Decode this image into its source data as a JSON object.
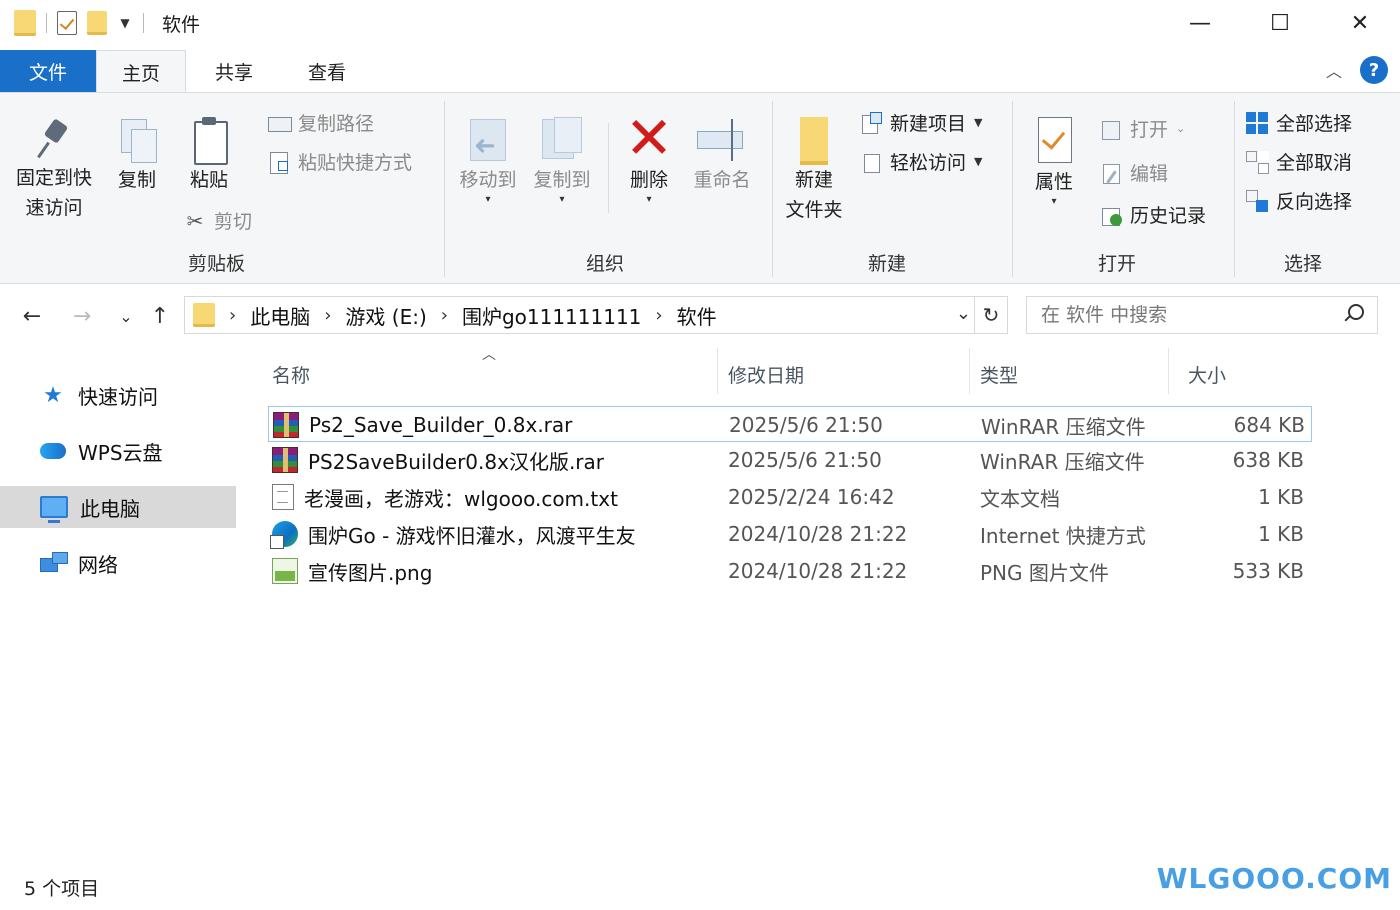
{
  "window": {
    "title": "软件",
    "minimize": "—",
    "maximize": "☐",
    "close": "✕"
  },
  "tabs": {
    "file": "文件",
    "home": "主页",
    "share": "共享",
    "view": "查看"
  },
  "ribbon": {
    "clipboard": {
      "label": "剪贴板",
      "pin_line1": "固定到快",
      "pin_line2": "速访问",
      "copy": "复制",
      "paste": "粘贴",
      "copy_path": "复制路径",
      "paste_shortcut": "粘贴快捷方式",
      "cut": "剪切"
    },
    "organize": {
      "label": "组织",
      "move_to": "移动到",
      "copy_to": "复制到",
      "delete": "删除",
      "rename": "重命名"
    },
    "new": {
      "label": "新建",
      "new_folder_line1": "新建",
      "new_folder_line2": "文件夹",
      "new_item": "新建项目",
      "easy_access": "轻松访问"
    },
    "open": {
      "label": "打开",
      "properties": "属性",
      "open": "打开",
      "edit": "编辑",
      "history": "历史记录"
    },
    "select": {
      "label": "选择",
      "select_all": "全部选择",
      "select_none": "全部取消",
      "invert": "反向选择"
    }
  },
  "nav": {
    "breadcrumbs": [
      "此电脑",
      "游戏 (E:)",
      "围炉go111111111",
      "软件"
    ],
    "search_placeholder": "在 软件 中搜索"
  },
  "sidebar": {
    "items": [
      {
        "label": "快速访问"
      },
      {
        "label": "WPS云盘"
      },
      {
        "label": "此电脑"
      },
      {
        "label": "网络"
      }
    ]
  },
  "columns": {
    "name": "名称",
    "modified": "修改日期",
    "type": "类型",
    "size": "大小"
  },
  "files": [
    {
      "name": "Ps2_Save_Builder_0.8x.rar",
      "modified": "2025/5/6 21:50",
      "type": "WinRAR 压缩文件",
      "size": "684 KB",
      "icon": "rar-icon"
    },
    {
      "name": "PS2SaveBuilder0.8x汉化版.rar",
      "modified": "2025/5/6 21:50",
      "type": "WinRAR 压缩文件",
      "size": "638 KB",
      "icon": "rar-icon"
    },
    {
      "name": "老漫画，老游戏：wlgooo.com.txt",
      "modified": "2025/2/24 16:42",
      "type": "文本文档",
      "size": "1 KB",
      "icon": "text-file-icon"
    },
    {
      "name": "围炉Go - 游戏怀旧灌水，风渡平生友",
      "modified": "2024/10/28 21:22",
      "type": "Internet 快捷方式",
      "size": "1 KB",
      "icon": "internet-shortcut-icon"
    },
    {
      "name": "宣传图片.png",
      "modified": "2024/10/28 21:22",
      "type": "PNG 图片文件",
      "size": "533 KB",
      "icon": "png-image-icon"
    }
  ],
  "status": {
    "count": "5 个项目"
  },
  "watermark": "WLGOOO.COM",
  "colors": {
    "accent": "#1a6fc9",
    "delete": "#d31a1a",
    "selection_border": "#99c8f0",
    "sidebar_selected": "#d9d9d9"
  }
}
